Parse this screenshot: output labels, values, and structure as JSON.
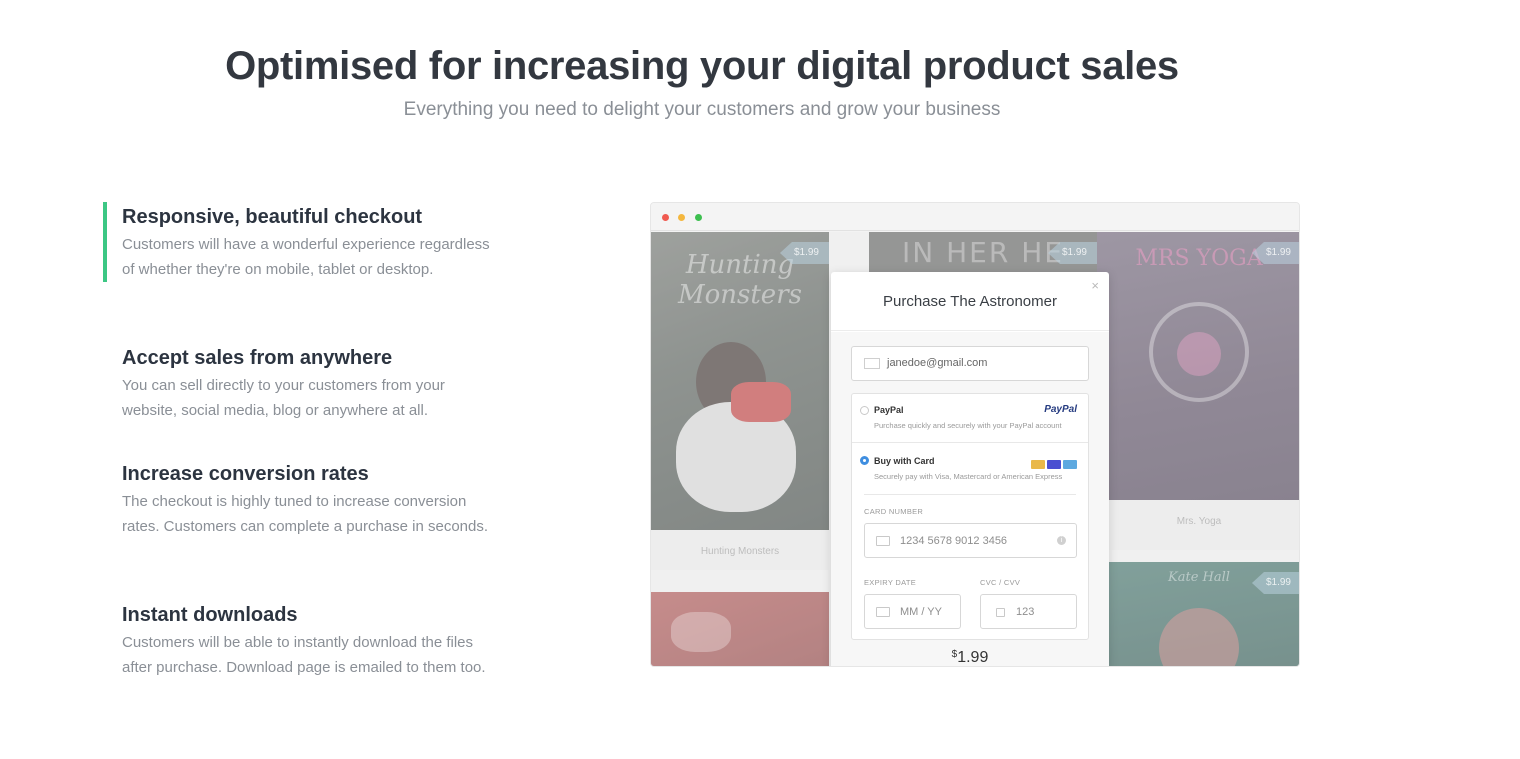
{
  "hero": {
    "title": "Optimised for increasing your digital product sales",
    "subtitle": "Everything you need to delight your customers and grow your business"
  },
  "features": [
    {
      "title": "Responsive, beautiful checkout",
      "text": "Customers will have a wonderful experience regardless of whether they're on mobile, tablet or desktop.",
      "active": true
    },
    {
      "title": "Accept sales from anywhere",
      "text": "You can sell directly to your customers from your website, social media, blog or anywhere at all.",
      "active": false
    },
    {
      "title": "Increase conversion rates",
      "text": "The checkout is highly tuned to increase conversion rates. Customers can complete a purchase in seconds.",
      "active": false
    },
    {
      "title": "Instant downloads",
      "text": "Customers will be able to instantly download the files after purchase. Download page is emailed to them too.",
      "active": false
    }
  ],
  "colors": {
    "accent": "#3cc784",
    "heading": "#2c3440",
    "muted": "#8a8f96",
    "radio_selected": "#3f8ee0"
  },
  "preview": {
    "products": [
      {
        "title": "Hunting Monsters",
        "cover_text": "Hunting Monsters",
        "price": "$1.99"
      },
      {
        "title": "",
        "cover_text": "IN HER HE",
        "price": "$1.99"
      },
      {
        "title": "Mrs. Yoga",
        "cover_text": "MRS YOGA",
        "price": "$1.99"
      },
      {
        "title": "",
        "cover_text": "Kate Hall",
        "price": "$1.99"
      }
    ],
    "checkout": {
      "title": "Purchase The Astronomer",
      "close": "×",
      "email_value": "janedoe@gmail.com",
      "paypal_label": "PayPal",
      "paypal_logo": "PayPal",
      "paypal_desc": "Purchase quickly and securely with your PayPal account",
      "card_label": "Buy with Card",
      "card_desc": "Securely pay with Visa, Mastercard or American Express",
      "card_number_label": "CARD NUMBER",
      "card_number_placeholder": "1234 5678 9012 3456",
      "expiry_label": "EXPIRY DATE",
      "expiry_placeholder": "MM / YY",
      "cvc_label": "CVC / CVV",
      "cvc_placeholder": "123",
      "currency": "$",
      "amount": "1.99",
      "selected_method": "card"
    }
  }
}
